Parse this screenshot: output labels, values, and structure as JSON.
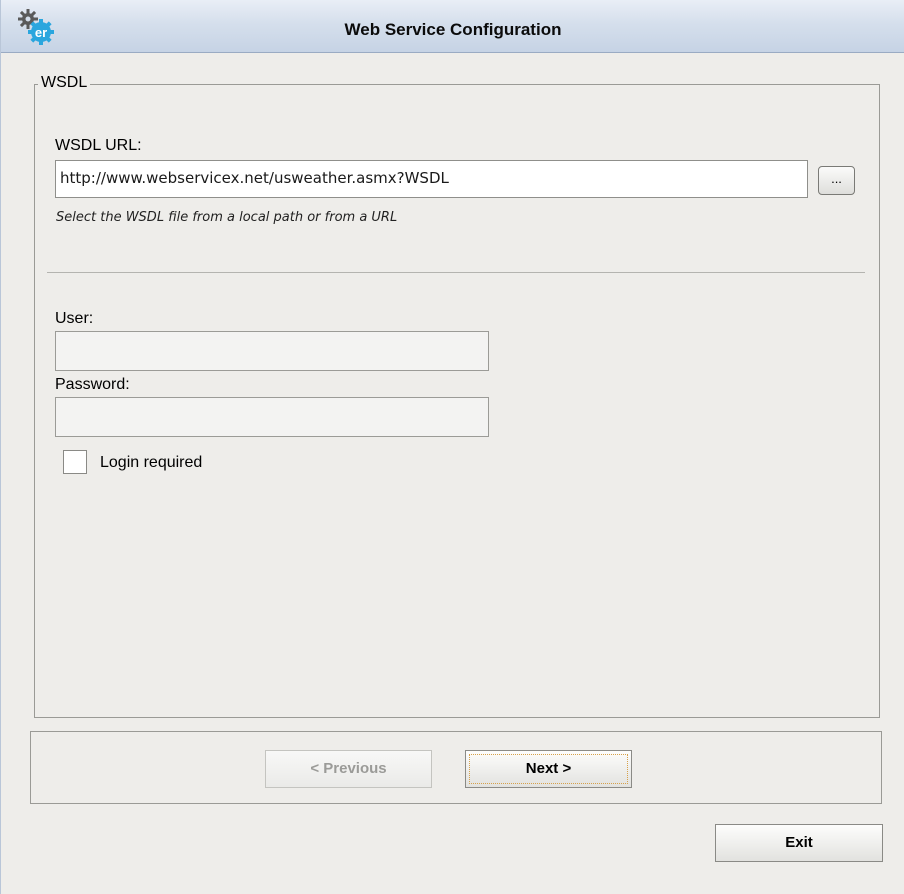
{
  "window": {
    "title": "Web Service Configuration",
    "icon": "gear-er-app-icon",
    "icon_badge_text": "er"
  },
  "wsdl_group": {
    "legend": "WSDL",
    "url_label": "WSDL URL:",
    "url_value": "http://www.webservicex.net/usweather.asmx?WSDL",
    "browse_label": "...",
    "hint": "Select the WSDL file from a local path or from a URL"
  },
  "auth": {
    "user_label": "User:",
    "user_value": "",
    "password_label": "Password:",
    "password_value": "",
    "login_required_label": "Login required",
    "login_required_checked": false
  },
  "navigation": {
    "previous_label": "< Previous",
    "previous_enabled": false,
    "next_label": "Next >",
    "exit_label": "Exit"
  },
  "colors": {
    "titlebar": "#d5dfec",
    "background": "#eeedea",
    "icon_blue": "#2aa6de"
  }
}
